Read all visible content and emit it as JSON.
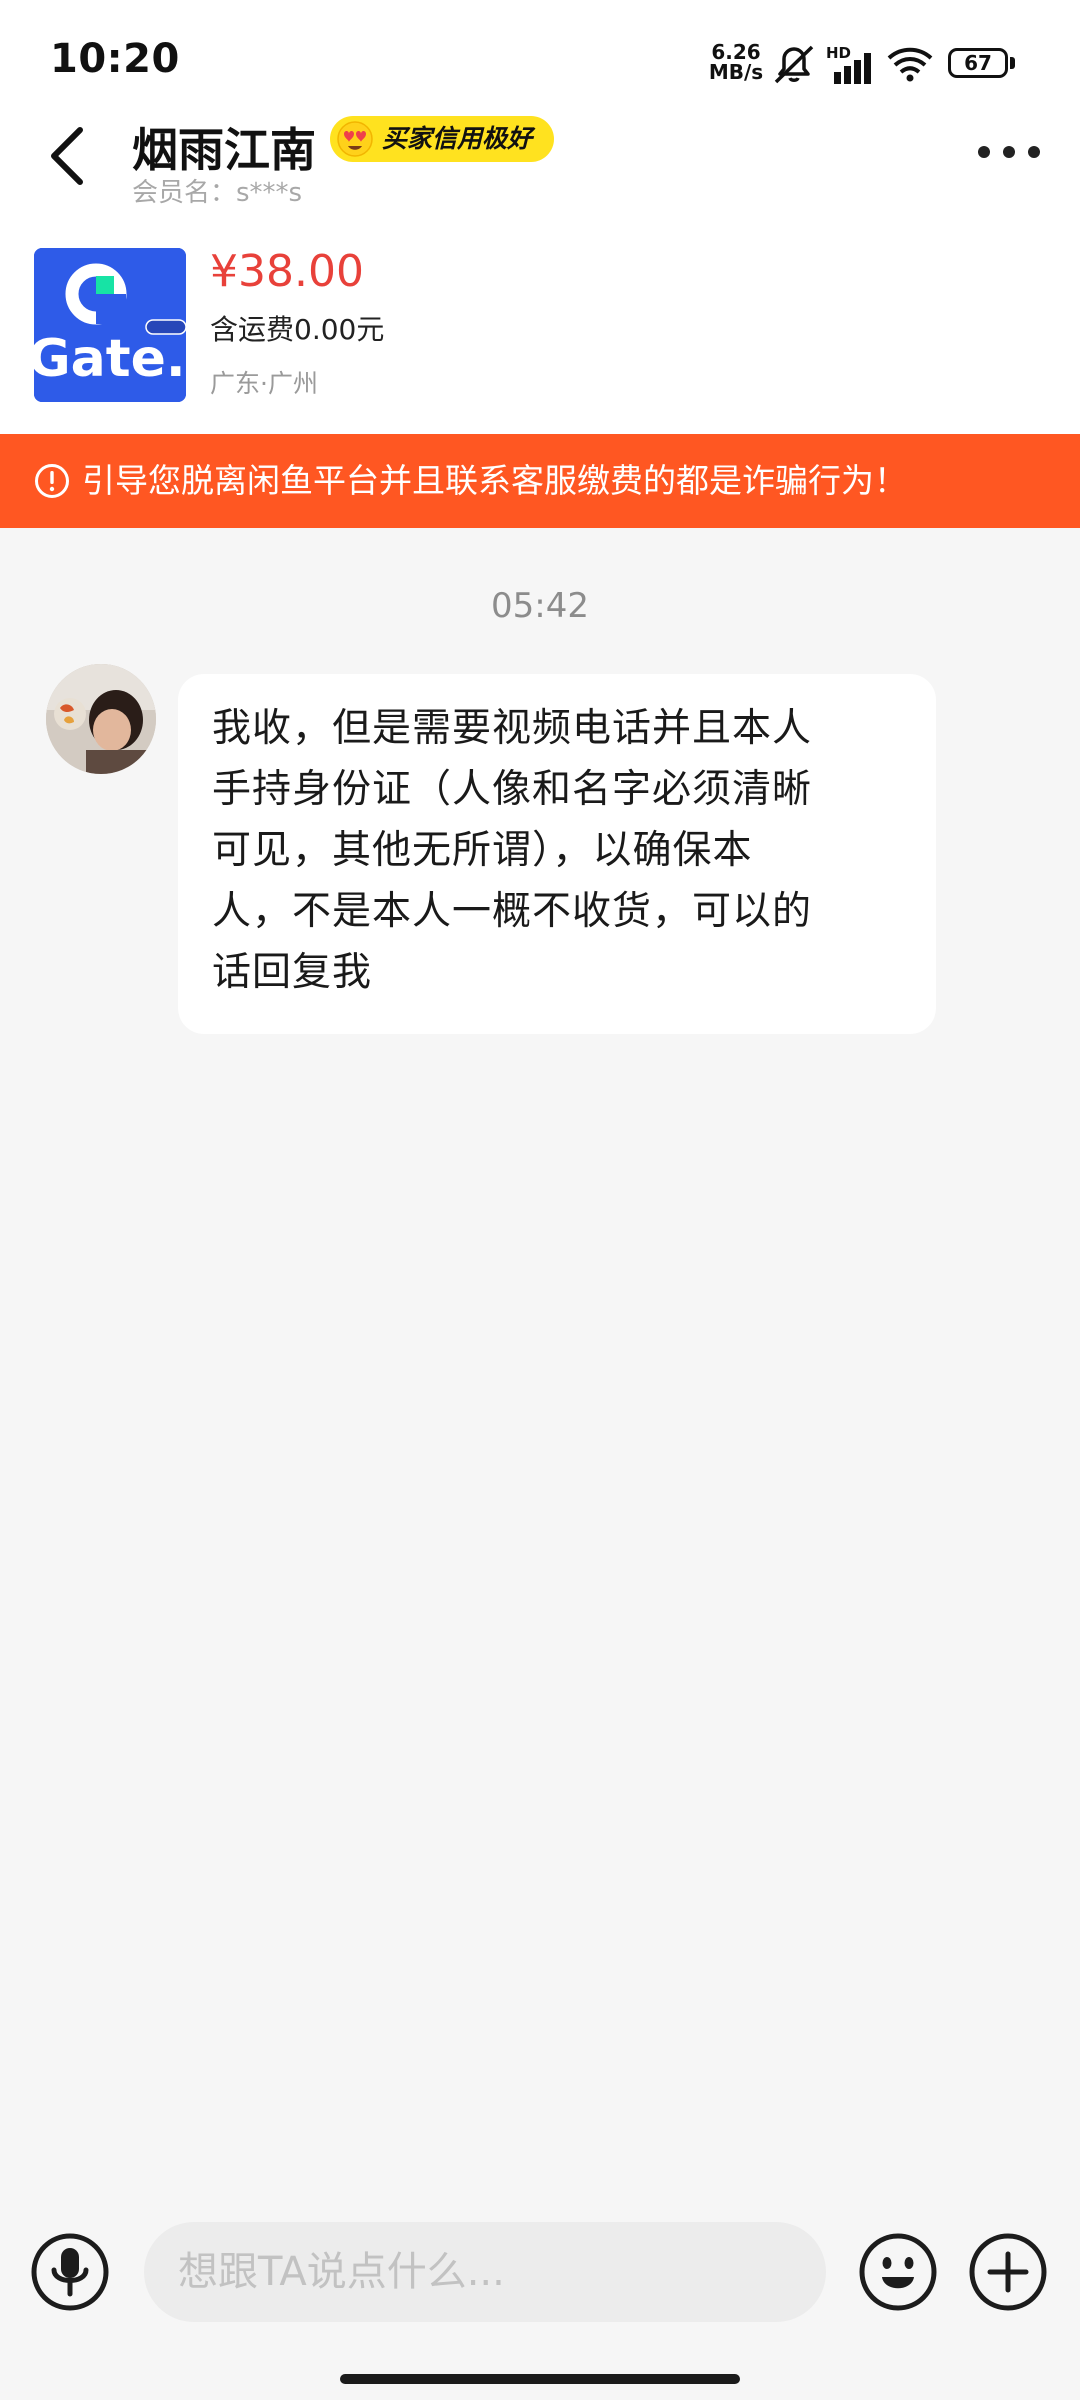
{
  "status_bar": {
    "time": "10:20",
    "net_speed_value": "6.26",
    "net_speed_unit": "MB/s",
    "hd_label": "HD",
    "battery": "67",
    "icons": [
      "mute-icon",
      "signal-icon",
      "wifi-icon",
      "battery-icon"
    ]
  },
  "header": {
    "title": "烟雨江南",
    "badge": "买家信用极好",
    "member_label": "会员名：s***s",
    "back_icon": "chevron-left-icon",
    "more_icon": "more-horizontal-icon"
  },
  "product": {
    "image_text": "Gate.io",
    "price": "¥38.00",
    "shipping": "含运费0.00元",
    "location": "广东·广州"
  },
  "warning": {
    "text": "引导您脱离闲鱼平台并且联系客服缴费的都是诈骗行为！",
    "icon": "alert-circle-icon"
  },
  "chat": {
    "time": "05:42",
    "messages": [
      {
        "lines": [
          "我收，但是需要视频电话并且本人",
          "手持身份证（人像和名字必须清晰",
          "可见，其他无所谓），以确保本",
          "人，不是本人一概不收货，可以的",
          "话回复我"
        ]
      }
    ]
  },
  "input_bar": {
    "placeholder": "想跟TA说点什么...",
    "icons": [
      "microphone-icon",
      "emoji-icon",
      "plus-icon"
    ]
  },
  "colors": {
    "price": "#e8413a",
    "warning_bg": "#ff5722",
    "badge_bg": "#ffe21f",
    "background": "#f6f6f6"
  }
}
